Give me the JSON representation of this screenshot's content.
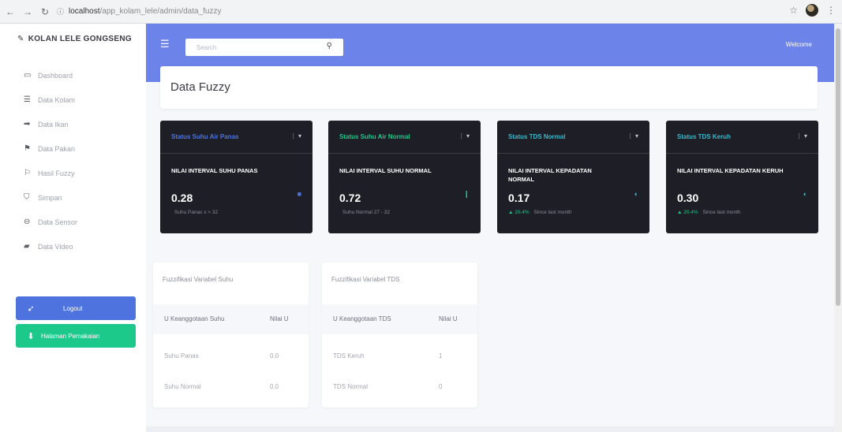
{
  "browser": {
    "url_host": "localhost",
    "url_path": "/app_kolam_lele/admin/data_fuzzy"
  },
  "sidebar": {
    "brand": "KOLAN LELE GONGSENG",
    "items": [
      {
        "label": "Dashboard",
        "icon": "monitor-icon"
      },
      {
        "label": "Data Kolam",
        "icon": "list-icon"
      },
      {
        "label": "Data Ikan",
        "icon": "fish-icon"
      },
      {
        "label": "Data Pakan",
        "icon": "tag-icon"
      },
      {
        "label": "Hasil Fuzzy",
        "icon": "flag-icon"
      },
      {
        "label": "Simpan",
        "icon": "save-icon"
      },
      {
        "label": "Data Sensor",
        "icon": "sensor-icon"
      },
      {
        "label": "Data Video",
        "icon": "video-icon"
      }
    ],
    "logout_label": "Logout",
    "help_label": "Halaman Pemakaian"
  },
  "topbar": {
    "search_placeholder": "Search",
    "welcome": "Welcome"
  },
  "page_title": "Data Fuzzy",
  "status_cards": [
    {
      "title": "Status Suhu Air Panas",
      "title_color": "#4e73df",
      "menu": "⋮ ▾",
      "label": "NILAI INTERVAL SUHU PANAS",
      "value": "0.28",
      "note": "Suhu Panas x > 32",
      "note_up": "",
      "icon_color": "#4e73df"
    },
    {
      "title": "Status Suhu Air Normal",
      "title_color": "#1cc88a",
      "menu": "⋮ ▾",
      "label": "NILAI INTERVAL SUHU NORMAL",
      "value": "0.72",
      "note": "Suhu Normal 27 - 32",
      "note_up": "",
      "icon_color": "#1cc88a"
    },
    {
      "title": "Status TDS Normal",
      "title_color": "#36b9cc",
      "menu": "⋮ ▾",
      "label": "NILAI INTERVAL KEPADATAN NORMAL",
      "value": "0.17",
      "note": "Since last month",
      "note_up": "▲ 20.4%",
      "icon_color": "#36b9cc"
    },
    {
      "title": "Status TDS Keruh",
      "title_color": "#36b9cc",
      "menu": "⋮ ▾",
      "label": "NILAI INTERVAL KEPADATAN KERUH",
      "value": "0.30",
      "note": "Since last month",
      "note_up": "▲ 20.4%",
      "icon_color": "#36b9cc"
    }
  ],
  "fuzzy_tables": [
    {
      "title": "Fuzzifikasi Variabel Suhu",
      "headers": [
        "U Keanggotaan Suhu",
        "Nilai U"
      ],
      "rows": [
        [
          "Suhu Panas",
          "0.0"
        ],
        [
          "Suhu Normal",
          "0.0"
        ]
      ]
    },
    {
      "title": "Fuzzifikasi Variabel TDS",
      "headers": [
        "U Keanggotaan TDS",
        "Nilai U"
      ],
      "rows": [
        [
          "TDS Keruh",
          "1"
        ],
        [
          "TDS Normal",
          "0"
        ]
      ]
    }
  ]
}
